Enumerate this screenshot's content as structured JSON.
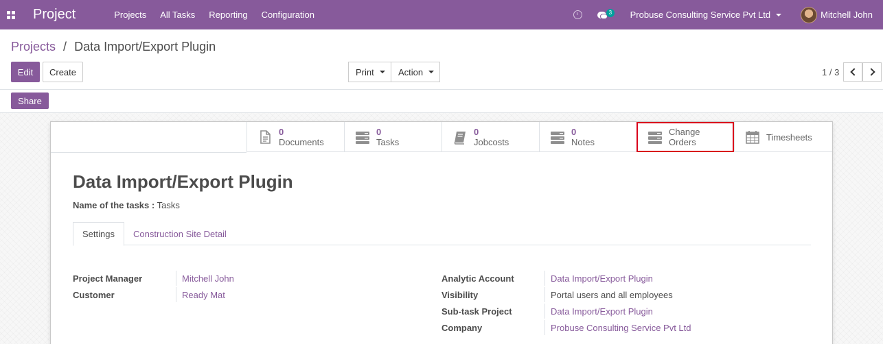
{
  "navbar": {
    "brand": "Project",
    "menu": [
      "Projects",
      "All Tasks",
      "Reporting",
      "Configuration"
    ],
    "chat_badge": "3",
    "company": "Probuse Consulting Service Pvt Ltd",
    "user": "Mitchell John",
    "accent": "#875a9b"
  },
  "breadcrumb": {
    "parent": "Projects",
    "separator": "/",
    "current": "Data Import/Export Plugin"
  },
  "toolbar": {
    "edit": "Edit",
    "create": "Create",
    "print": "Print",
    "action": "Action",
    "share": "Share",
    "pager": "1 / 3"
  },
  "stat_buttons": [
    {
      "value": "0",
      "label": "Documents",
      "icon": "document-icon"
    },
    {
      "value": "0",
      "label": "Tasks",
      "icon": "server-icon"
    },
    {
      "value": "0",
      "label": "Jobcosts",
      "icon": "book-icon"
    },
    {
      "value": "0",
      "label": "Notes",
      "icon": "server-icon"
    },
    {
      "value": "Change",
      "label": "Orders",
      "icon": "server-icon"
    },
    {
      "value": "",
      "label": "Timesheets",
      "icon": "calendar-icon"
    }
  ],
  "record": {
    "title": "Data Import/Export Plugin",
    "task_name_label": "Name of the tasks :",
    "task_name_value": "Tasks"
  },
  "tabs": [
    "Settings",
    "Construction Site Detail"
  ],
  "left_fields": [
    {
      "label": "Project Manager",
      "value": "Mitchell John"
    },
    {
      "label": "Customer",
      "value": "Ready Mat"
    }
  ],
  "right_fields": [
    {
      "label": "Analytic Account",
      "value": "Data Import/Export Plugin"
    },
    {
      "label": "Visibility",
      "value": "Portal users and all employees"
    },
    {
      "label": "Sub-task Project",
      "value": "Data Import/Export Plugin"
    },
    {
      "label": "Company",
      "value": "Probuse Consulting Service Pvt Ltd"
    }
  ]
}
